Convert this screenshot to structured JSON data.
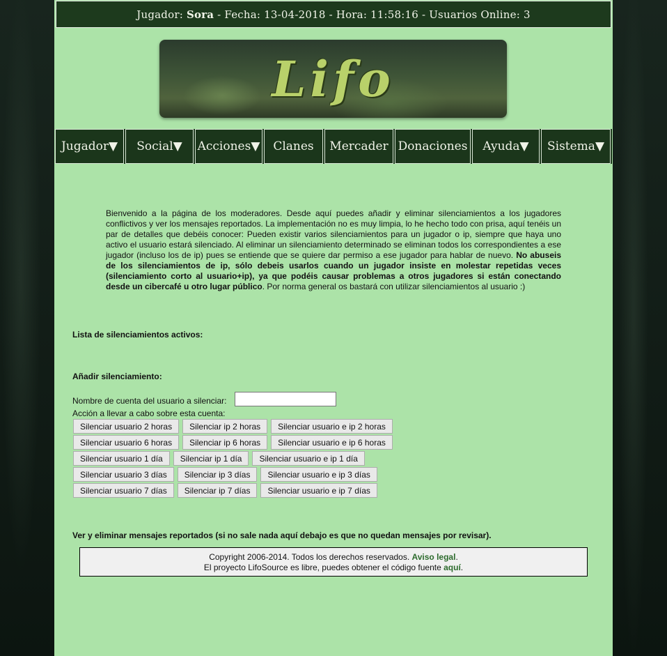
{
  "status_bar": {
    "player_label": "Jugador:",
    "player_name": "Sora",
    "date_label": "- Fecha:",
    "date": "13-04-2018",
    "time_label": "- Hora:",
    "time": "11:58:16",
    "online_label": "- Usuarios Online:",
    "online": "3"
  },
  "banner": {
    "logo_text": "Lifo"
  },
  "nav": {
    "items": [
      {
        "label": "Jugador▼"
      },
      {
        "label": "Social▼"
      },
      {
        "label": "Acciones▼"
      },
      {
        "label": "Clanes"
      },
      {
        "label": "Mercader"
      },
      {
        "label": "Donaciones"
      },
      {
        "label": "Ayuda▼"
      },
      {
        "label": "Sistema▼"
      }
    ]
  },
  "intro": {
    "p1": "Bienvenido a la página de los moderadores. Desde aquí puedes añadir y eliminar silenciamientos a los jugadores conflictivos y ver los mensajes reportados. La implementación no es muy limpia, lo he hecho todo con prisa, aquí tenéis un par de detalles que debéis conocer: Pueden existir varios silenciamientos para un jugador o ip, siempre que haya uno activo el usuario estará silenciado. Al eliminar un silenciamiento determinado se eliminan todos los correspondientes a ese jugador (incluso los de ip) pues se entiende que se quiere dar permiso a ese jugador para hablar de nuevo. ",
    "bold": "No abuseis de los silenciamientos de ip, sólo debeis usarlos cuando un jugador insiste en molestar repetidas veces (silenciamiento corto al usuario+ip), ya que podéis causar problemas a otros jugadores si están conectando desde un cibercafé u otro lugar público",
    "p2": ". Por norma general os bastará con utilizar silenciamientos al usuario :)"
  },
  "active_list_title": "Lista de silenciamientos activos:",
  "add_title": "Añadir silenciamiento:",
  "account_label": "Nombre de cuenta del usuario a silenciar:",
  "account_value": "",
  "action_label": "Acción a llevar a cabo sobre esta cuenta:",
  "buttons": [
    [
      "Silenciar usuario 2 horas",
      "Silenciar ip 2 horas",
      "Silenciar usuario e ip 2 horas"
    ],
    [
      "Silenciar usuario 6 horas",
      "Silenciar ip 6 horas",
      "Silenciar usuario e ip 6 horas"
    ],
    [
      "Silenciar usuario 1 día",
      "Silenciar ip 1 día",
      "Silenciar usuario e ip 1 día"
    ],
    [
      "Silenciar usuario 3 días",
      "Silenciar ip 3 días",
      "Silenciar usuario e ip 3 días"
    ],
    [
      "Silenciar usuario 7 días",
      "Silenciar ip 7 días",
      "Silenciar usuario e ip 7 días"
    ]
  ],
  "reports_title": "Ver y eliminar mensajes reportados (si no sale nada aquí debajo es que no quedan mensajes por revisar).",
  "footer": {
    "copyright": "Copyright 2006-2014. Todos los derechos reservados. ",
    "legal_link": "Aviso legal",
    "legal_end": ".",
    "source_text": "El proyecto LifoSource es libre, puedes obtener el código fuente ",
    "source_link": "aquí",
    "source_end": "."
  }
}
